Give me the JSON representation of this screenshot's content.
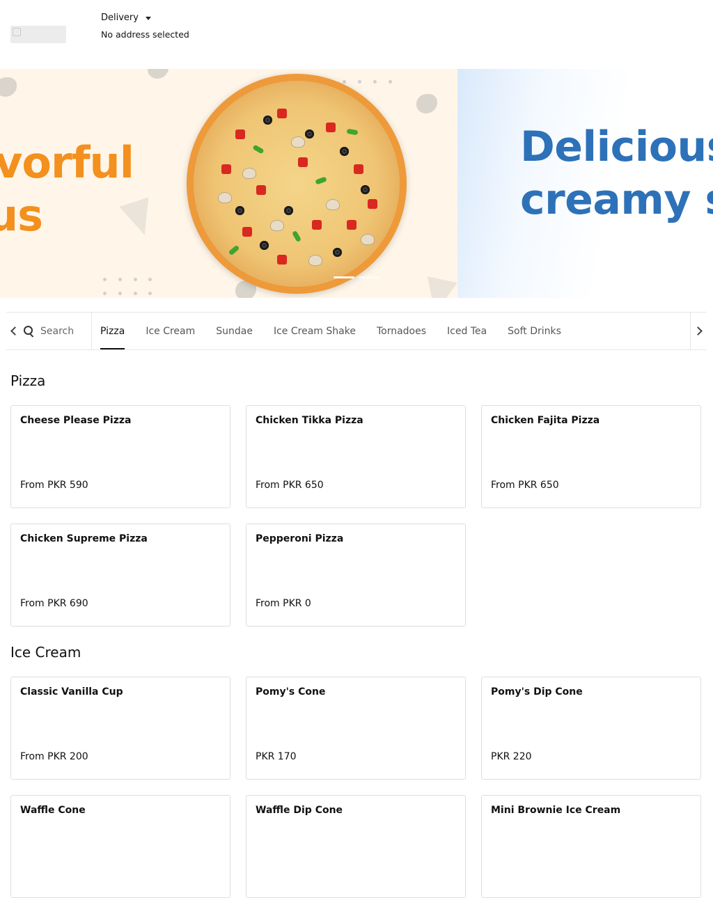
{
  "header": {
    "logo_alt": "",
    "order_type": "Delivery",
    "address": "No address selected"
  },
  "banner": {
    "slide1_line1": "vorful",
    "slide1_line2": "us",
    "slide2_line1": "Deliciousl",
    "slide2_line2": "creamy sw",
    "colors": {
      "slide1_text": "#f3901e",
      "slide2_text": "#2d71b8"
    }
  },
  "nav": {
    "search_placeholder": "Search",
    "tabs": [
      "Pizza",
      "Ice Cream",
      "Sundae",
      "Ice Cream Shake",
      "Tornadoes",
      "Iced Tea",
      "Soft Drinks"
    ],
    "active_tab": "Pizza"
  },
  "sections": [
    {
      "title": "Pizza",
      "items": [
        {
          "name": "Cheese Please Pizza",
          "price": "From PKR 590"
        },
        {
          "name": "Chicken Tikka Pizza",
          "price": "From PKR 650"
        },
        {
          "name": "Chicken Fajita Pizza",
          "price": "From PKR 650"
        },
        {
          "name": "Chicken Supreme Pizza",
          "price": "From PKR 690"
        },
        {
          "name": "Pepperoni Pizza",
          "price": "From PKR 0"
        }
      ]
    },
    {
      "title": "Ice Cream",
      "items": [
        {
          "name": "Classic Vanilla Cup",
          "price": "From PKR 200"
        },
        {
          "name": "Pomy's Cone",
          "price": "PKR 170"
        },
        {
          "name": "Pomy's Dip Cone",
          "price": "PKR 220"
        },
        {
          "name": "Waffle Cone",
          "price": ""
        },
        {
          "name": "Waffle Dip Cone",
          "price": ""
        },
        {
          "name": "Mini Brownie Ice Cream",
          "price": ""
        }
      ]
    }
  ]
}
